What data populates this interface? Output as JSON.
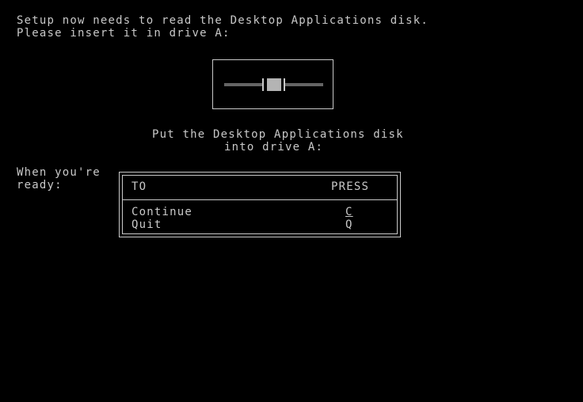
{
  "header": {
    "line1": "Setup now needs to read the Desktop Applications disk.",
    "line2": "Please insert it in drive A:"
  },
  "illustration": {
    "icon": "floppy-drive-icon"
  },
  "prompt": {
    "line1": "Put the Desktop Applications disk",
    "line2": "into drive A:"
  },
  "ready": {
    "line1": "When you're",
    "line2": "ready:"
  },
  "options": {
    "header_to": "TO",
    "header_press": "PRESS",
    "rows": [
      {
        "label": "Continue",
        "key": "C"
      },
      {
        "label": "Quit",
        "key": "Q"
      }
    ]
  },
  "colors": {
    "background": "#000000",
    "text": "#c8c8c8"
  }
}
